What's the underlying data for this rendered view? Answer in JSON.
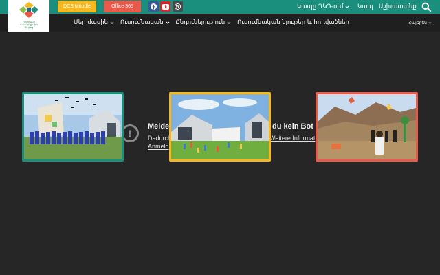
{
  "logo": {
    "text_line1": "Դիլիջանի",
    "text_line2": "Համայնքային",
    "text_line3": "Դպրոց"
  },
  "topbar": {
    "moodle_label": "DCS Moodle",
    "office_label": "Office 365",
    "contact_label": "Կապը ԴԿԴ-ում",
    "links_label": "Կապ",
    "start_label": "Աշխատանք",
    "social": [
      "facebook-icon",
      "youtube-icon",
      "wordpress-icon"
    ],
    "colors": {
      "bar": "#1a8f7d",
      "moodle": "#f5b820",
      "office": "#ea5a4b"
    }
  },
  "nav": {
    "items": [
      {
        "label": "Մեր մասին"
      },
      {
        "label": "Ուսումնական"
      },
      {
        "label": "Ընդունելություն"
      },
      {
        "label": "Ուսումնական նյութեր և հոդվածներ"
      }
    ],
    "language": "Հայերեն"
  },
  "notice": {
    "title": "Melde",
    "title_end": "du kein Bot bi",
    "line": "Dadurch",
    "link": "Anmeld",
    "more": "Weitere Informat"
  },
  "cards": [
    {
      "name": "graduation-photo",
      "border": "#1a8f7d"
    },
    {
      "name": "school-yard-photo",
      "border": "#f5b820"
    },
    {
      "name": "kite-hill-photo",
      "border": "#ea5a4b"
    }
  ]
}
